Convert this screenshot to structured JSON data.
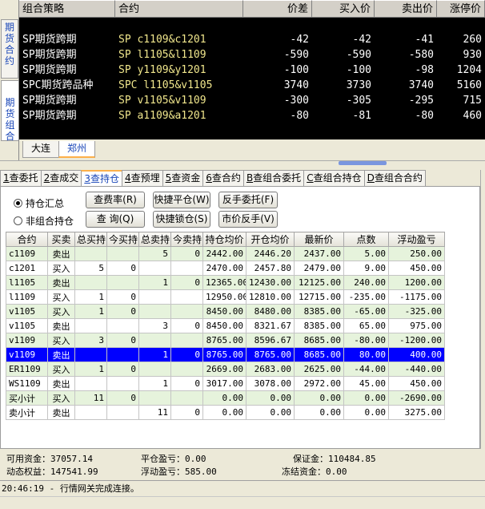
{
  "quote": {
    "vertical_tabs": [
      "期货合约",
      "期货组合"
    ],
    "headers": [
      "组合策略",
      "合约",
      "价差",
      "买入价",
      "卖出价",
      "涨停价"
    ],
    "rows": [
      {
        "strategy": "SP期货跨期",
        "contract": "SP c1109&c1201",
        "spread": "-42",
        "bid": "-42",
        "ask": "-41",
        "limit_up": "260"
      },
      {
        "strategy": "SP期货跨期",
        "contract": "SP l1105&l1109",
        "spread": "-590",
        "bid": "-590",
        "ask": "-580",
        "limit_up": "930"
      },
      {
        "strategy": "SP期货跨期",
        "contract": "SP y1109&y1201",
        "spread": "-100",
        "bid": "-100",
        "ask": "-98",
        "limit_up": "1204"
      },
      {
        "strategy": "SPC期货跨品种",
        "contract": "SPC l1105&v1105",
        "spread": "3740",
        "bid": "3730",
        "ask": "3740",
        "limit_up": "5160"
      },
      {
        "strategy": "SP期货跨期",
        "contract": "SP v1105&v1109",
        "spread": "-300",
        "bid": "-305",
        "ask": "-295",
        "limit_up": "715"
      },
      {
        "strategy": "SP期货跨期",
        "contract": "SP a1109&a1201",
        "spread": "-80",
        "bid": "-81",
        "ask": "-80",
        "limit_up": "460"
      }
    ],
    "exchange_tabs": [
      "大连",
      "郑州"
    ],
    "active_exchange": "郑州"
  },
  "func_tabs": [
    {
      "key": "1",
      "label": "查委托"
    },
    {
      "key": "2",
      "label": "查成交"
    },
    {
      "key": "3",
      "label": "查持仓"
    },
    {
      "key": "4",
      "label": "查预埋"
    },
    {
      "key": "5",
      "label": "查资金"
    },
    {
      "key": "6",
      "label": "查合约"
    },
    {
      "key": "B",
      "label": "查组合委托"
    },
    {
      "key": "C",
      "label": "查组合持仓"
    },
    {
      "key": "D",
      "label": "查组合合约"
    }
  ],
  "active_func_tab": "3",
  "radios": {
    "summary": "持仓汇总",
    "non_combo": "非组合持仓",
    "selected": "summary"
  },
  "buttons": {
    "fee_rate": "查费率(R)",
    "query": "查 询(Q)",
    "quick_close": "快捷平仓(W)",
    "quick_lock": "快捷锁仓(S)",
    "reverse_order": "反手委托(F)",
    "market_reverse": "市价反手(V)"
  },
  "grid": {
    "headers": [
      "合约",
      "买卖",
      "总买持",
      "今买持",
      "总卖持",
      "今卖持",
      "持仓均价",
      "开仓均价",
      "最新价",
      "点数",
      "浮动盈亏"
    ],
    "rows": [
      [
        "c1109",
        "卖出",
        "",
        "",
        "5",
        "0",
        "2442.00",
        "2446.20",
        "2437.00",
        "5.00",
        "250.00"
      ],
      [
        "c1201",
        "买入",
        "5",
        "0",
        "",
        "",
        "2470.00",
        "2457.80",
        "2479.00",
        "9.00",
        "450.00"
      ],
      [
        "l1105",
        "卖出",
        "",
        "",
        "1",
        "0",
        "12365.00",
        "12430.00",
        "12125.00",
        "240.00",
        "1200.00"
      ],
      [
        "l1109",
        "买入",
        "1",
        "0",
        "",
        "",
        "12950.00",
        "12810.00",
        "12715.00",
        "-235.00",
        "-1175.00"
      ],
      [
        "v1105",
        "买入",
        "1",
        "0",
        "",
        "",
        "8450.00",
        "8480.00",
        "8385.00",
        "-65.00",
        "-325.00"
      ],
      [
        "v1105",
        "卖出",
        "",
        "",
        "3",
        "0",
        "8450.00",
        "8321.67",
        "8385.00",
        "65.00",
        "975.00"
      ],
      [
        "v1109",
        "买入",
        "3",
        "0",
        "",
        "",
        "8765.00",
        "8596.67",
        "8685.00",
        "-80.00",
        "-1200.00"
      ],
      [
        "v1109",
        "卖出",
        "",
        "",
        "1",
        "0",
        "8765.00",
        "8765.00",
        "8685.00",
        "80.00",
        "400.00"
      ],
      [
        "ER1109",
        "买入",
        "1",
        "0",
        "",
        "",
        "2669.00",
        "2683.00",
        "2625.00",
        "-44.00",
        "-440.00"
      ],
      [
        "WS1109",
        "卖出",
        "",
        "",
        "1",
        "0",
        "3017.00",
        "3078.00",
        "2972.00",
        "45.00",
        "450.00"
      ],
      [
        "买小计",
        "买入",
        "11",
        "0",
        "",
        "",
        "0.00",
        "0.00",
        "0.00",
        "0.00",
        "-2690.00"
      ],
      [
        "卖小计",
        "卖出",
        "",
        "",
        "11",
        "0",
        "0.00",
        "0.00",
        "0.00",
        "0.00",
        "3275.00"
      ]
    ],
    "selected_row": 7
  },
  "summary": {
    "available_funds_label": "可用资金：",
    "available_funds": "37057.14",
    "close_pnl_label": "平仓盈亏：",
    "close_pnl": "0.00",
    "margin_label": "保证金：",
    "margin": "110484.85",
    "dynamic_equity_label": "动态权益：",
    "dynamic_equity": "147541.99",
    "floating_pnl_label": "浮动盈亏：",
    "floating_pnl": "585.00",
    "frozen_funds_label": "冻结资金：",
    "frozen_funds": "0.00"
  },
  "status": "20:46:19 - 行情网关完成连接。"
}
